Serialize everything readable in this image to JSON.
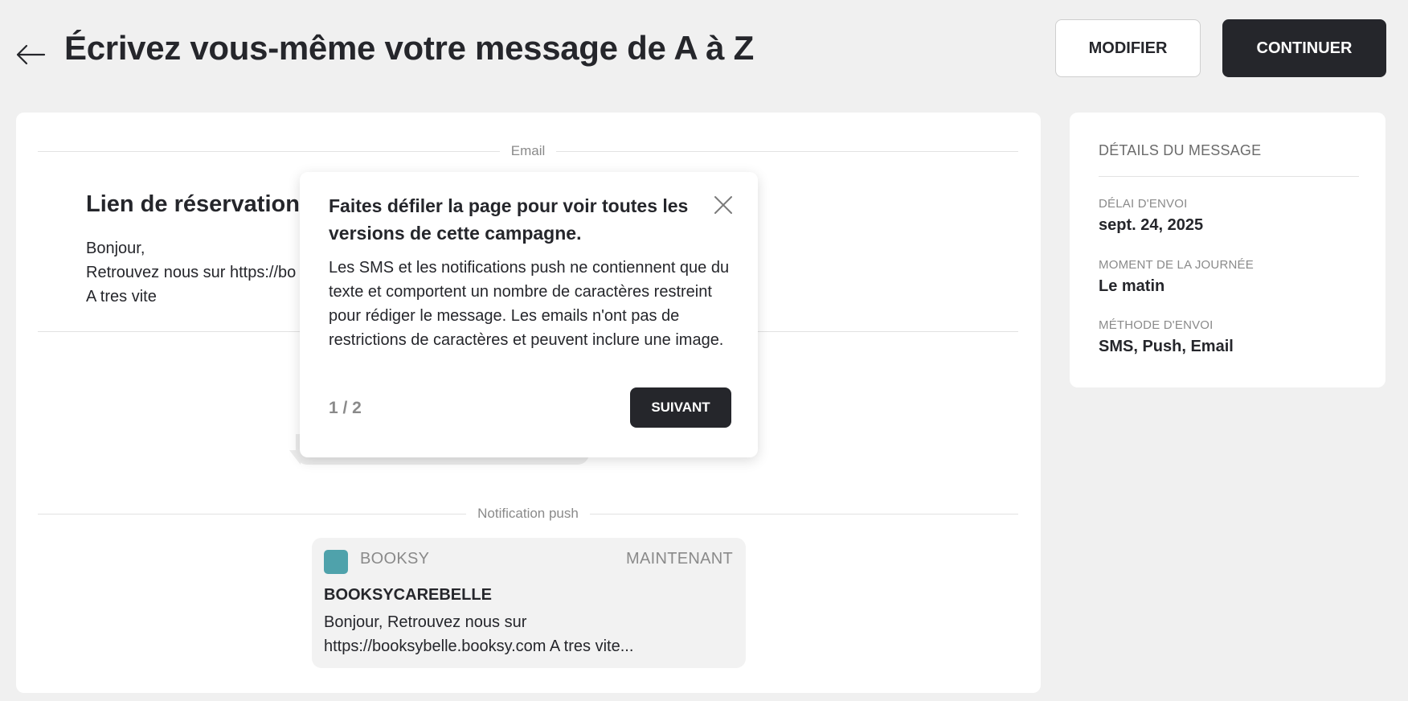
{
  "header": {
    "title": "Écrivez vous-même votre message de A à Z",
    "modify_label": "MODIFIER",
    "continue_label": "CONTINUER"
  },
  "main": {
    "email_section_label": "Email",
    "email": {
      "title": "Lien de réservation",
      "body_lines": [
        "Bonjour,",
        "Retrouvez nous sur https://bo",
        "A tres vite"
      ]
    },
    "push_section_label": "Notification push",
    "push": {
      "app_name": "BOOKSY",
      "time": "MAINTENANT",
      "title": "BOOKSYCAREBELLE",
      "body": "Bonjour, Retrouvez nous sur https://booksybelle.booksy.com A tres vite..."
    }
  },
  "tooltip": {
    "title": "Faites défiler la page pour voir toutes les versions de cette campagne.",
    "body": "Les SMS et les notifications push ne contiennent que du texte et comportent un nombre de caractères restreint pour rédiger le message. Les emails n'ont pas de restrictions de caractères et peuvent inclure une image.",
    "step": "1 / 2",
    "next_label": "SUIVANT"
  },
  "details": {
    "heading": "DÉTAILS DU MESSAGE",
    "items": [
      {
        "label": "DÉLAI D'ENVOI",
        "value": "sept. 24, 2025"
      },
      {
        "label": "MOMENT DE LA JOURNÉE",
        "value": "Le matin"
      },
      {
        "label": "MÉTHODE D'ENVOI",
        "value": "SMS, Push, Email"
      }
    ]
  },
  "colors": {
    "background": "#f0f0f0",
    "dark": "#25262b",
    "app_icon": "#4fa2ab",
    "muted": "#8a8a8a"
  },
  "icons": {
    "back": "arrow-left-icon",
    "close": "close-icon",
    "app": "booksy-app-icon"
  }
}
